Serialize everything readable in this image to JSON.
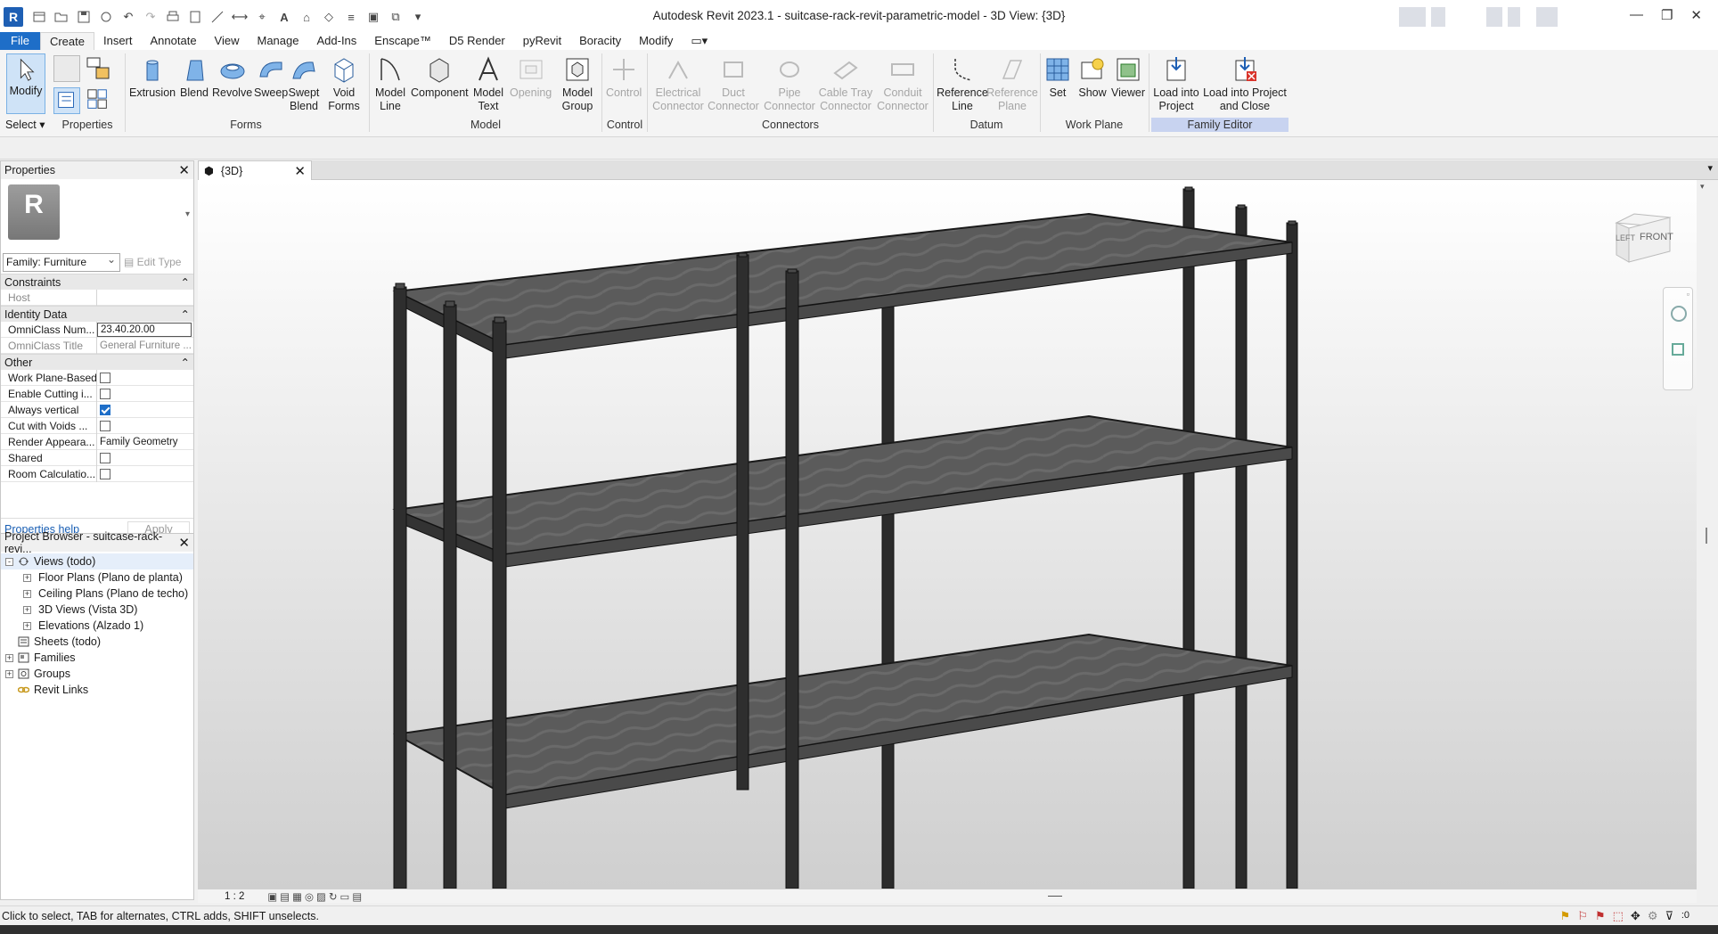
{
  "app": {
    "title": "Autodesk Revit 2023.1 - suitcase-rack-revit-parametric-model - 3D View: {3D}",
    "logo_letter": "R"
  },
  "tabs": [
    "File",
    "Create",
    "Insert",
    "Annotate",
    "View",
    "Manage",
    "Add-Ins",
    "Enscape™",
    "D5 Render",
    "pyRevit",
    "Boracity",
    "Modify"
  ],
  "active_tab": "Create",
  "ribbon": {
    "select": {
      "modify": "Modify",
      "select": "Select",
      "properties": "Properties"
    },
    "forms": {
      "label": "Forms",
      "buttons": [
        "Extrusion",
        "Blend",
        "Revolve",
        "Sweep",
        "Swept Blend",
        "Void Forms"
      ]
    },
    "model": {
      "label": "Model",
      "buttons": [
        "Model Line",
        "Component",
        "Model Text",
        "Opening",
        "Model Group"
      ]
    },
    "control": {
      "label": "Control",
      "buttons": [
        "Control"
      ]
    },
    "connectors": {
      "label": "Connectors",
      "buttons": [
        "Electrical Connector",
        "Duct Connector",
        "Pipe Connector",
        "Cable Tray Connector",
        "Conduit Connector"
      ]
    },
    "datum": {
      "label": "Datum",
      "buttons": [
        "Reference Line",
        "Reference Plane"
      ]
    },
    "workplane": {
      "label": "Work Plane",
      "buttons": [
        "Set",
        "Show",
        "Viewer"
      ]
    },
    "family_editor": {
      "label": "Family Editor",
      "buttons": [
        "Load into Project",
        "Load into Project and Close"
      ]
    }
  },
  "properties": {
    "title": "Properties",
    "badge": "R",
    "type": "Family: Furniture",
    "edit_type": "Edit Type",
    "sections": [
      {
        "name": "Constraints",
        "rows": [
          {
            "key": "Host",
            "value": "",
            "grey": true
          }
        ]
      },
      {
        "name": "Identity Data",
        "rows": [
          {
            "key": "OmniClass Num...",
            "value": "23.40.20.00",
            "box": true
          },
          {
            "key": "OmniClass Title",
            "value": "General Furniture ...",
            "grey": true
          }
        ]
      },
      {
        "name": "Other",
        "rows": [
          {
            "key": "Work Plane-Based",
            "check": false
          },
          {
            "key": "Enable Cutting i...",
            "check": false
          },
          {
            "key": "Always vertical",
            "check": true
          },
          {
            "key": "Cut with Voids ...",
            "check": false
          },
          {
            "key": "Render Appeara...",
            "value": "Family Geometry"
          },
          {
            "key": "Shared",
            "check": false
          },
          {
            "key": "Room Calculatio...",
            "check": false
          }
        ]
      }
    ],
    "help": "Properties help",
    "apply": "Apply"
  },
  "browser": {
    "title": "Project Browser - suitcase-rack-revi...",
    "nodes": [
      {
        "label": "Views (todo)",
        "level": 0,
        "exp": "-",
        "icon": "views-icon",
        "selected": true
      },
      {
        "label": "Floor Plans (Plano de planta)",
        "level": 1,
        "exp": "+"
      },
      {
        "label": "Ceiling Plans (Plano de techo)",
        "level": 1,
        "exp": "+"
      },
      {
        "label": "3D Views (Vista 3D)",
        "level": 1,
        "exp": "+"
      },
      {
        "label": "Elevations (Alzado 1)",
        "level": 1,
        "exp": "+"
      },
      {
        "label": "Sheets (todo)",
        "level": 0,
        "exp": "",
        "icon": "sheets-icon"
      },
      {
        "label": "Families",
        "level": 0,
        "exp": "+",
        "icon": "families-icon"
      },
      {
        "label": "Groups",
        "level": 0,
        "exp": "+",
        "icon": "groups-icon"
      },
      {
        "label": "Revit Links",
        "level": 0,
        "exp": "",
        "icon": "links-icon"
      }
    ]
  },
  "view": {
    "tab": "{3D}",
    "scale": "1 : 2",
    "viewcube_left": "LEFT",
    "viewcube_front": "FRONT"
  },
  "status": {
    "text": "Click to select, TAB for alternates, CTRL adds, SHIFT unselects.",
    "filter_count": ":0"
  }
}
